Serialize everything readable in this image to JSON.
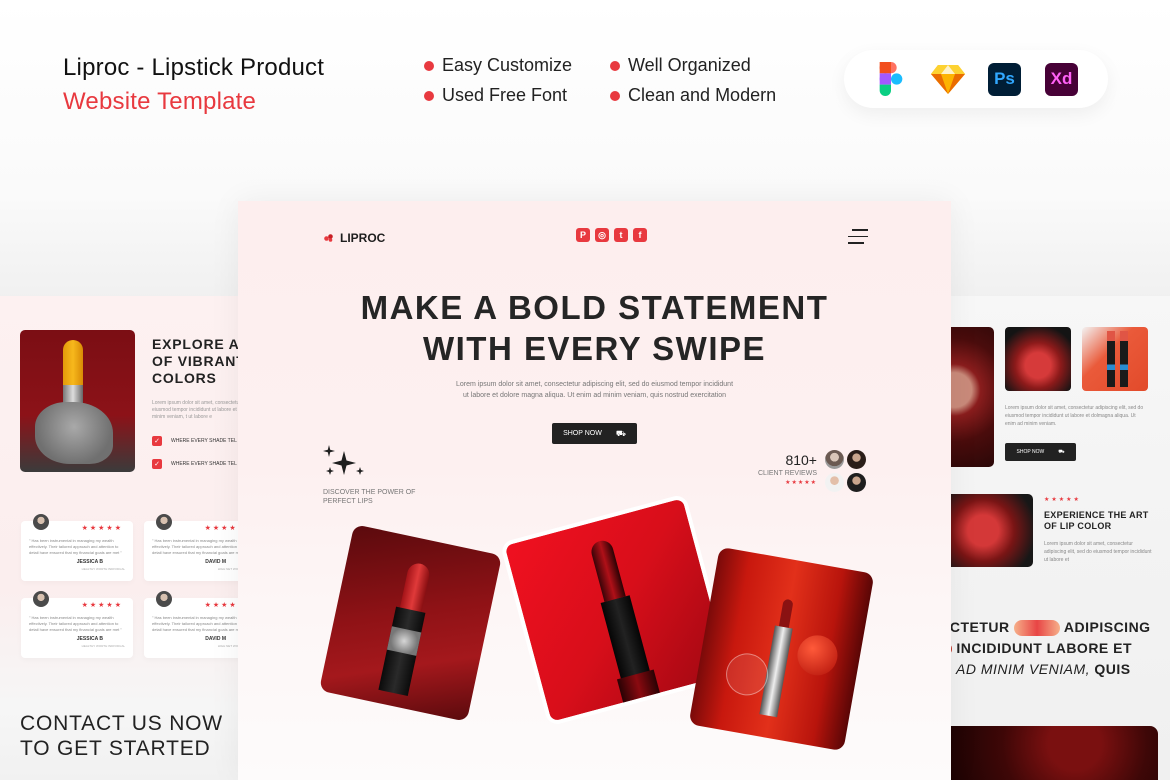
{
  "header": {
    "title_line1": "Liproc - Lipstick Product",
    "title_line2": "Website Template",
    "features": [
      "Easy Customize",
      "Well Organized",
      "Used Free Font",
      "Clean and Modern"
    ],
    "tools": [
      {
        "name": "figma-icon",
        "label": ""
      },
      {
        "name": "sketch-icon",
        "label": ""
      },
      {
        "name": "photoshop-icon",
        "label": "Ps"
      },
      {
        "name": "xd-icon",
        "label": "Xd"
      }
    ]
  },
  "main": {
    "logo": "LIPROC",
    "social": [
      "P",
      "◎",
      "t",
      "f"
    ],
    "hero_line1": "MAKE A BOLD STATEMENT",
    "hero_line2": "WITH EVERY SWIPE",
    "subtext_line1": "Lorem ipsum dolor sit amet, consectetur adipiscing elit, sed do eiusmod tempor incididunt",
    "subtext_line2": "ut labore et dolore magna aliqua. Ut enim ad minim veniam, quis nostrud exercitation",
    "shop_label": "SHOP NOW",
    "cart_icon": "🛒",
    "sparkle": "✦",
    "discover_line1": "DISCOVER THE POWER OF",
    "discover_line2": "PERFECT LIPS",
    "reviews_count": "810+",
    "reviews_label": "CLIENT REVIEWS",
    "reviews_stars": "★★★★★"
  },
  "left": {
    "explore_line1": "EXPLORE A V",
    "explore_line2": "OF VIBRANT",
    "explore_line3": "COLORS",
    "text": "Lorem ipsum dolor sit amet, consectetur adi eiusmod tempor incididunt ut labore et dolm minim veniam, t ut labore e",
    "checks": [
      "WHERE EVERY SHADE TEL",
      "WHERE EVERY SHADE TEL"
    ],
    "testimonials": [
      {
        "quote": "\" Has been instrumental in managing my wealth effectively. Their tailored approach and attention to detail have ensured that my financial goals are met \"",
        "name": "JESSICA B",
        "role": "HEALTHY WORTH INDIVIDUAL",
        "stars": "★★★★★"
      },
      {
        "quote": "\" Has been instrumental in managing my wealth effectively. Their tailored approach and attention to detail have ensured that my financial goals are met \"",
        "name": "DAVID M",
        "role": "HIGH NET WORTH IN",
        "stars": "★★★★★"
      },
      {
        "quote": "\" Has been instrumental in managing my wealth effectively. Their tailored approach and attention to detail have ensured that my financial goals are met \"",
        "name": "JESSICA B",
        "role": "HEALTHY WORTH INDIVIDUAL",
        "stars": "★★★★★"
      },
      {
        "quote": "\" Has been instrumental in managing my wealth effectively. Their tailored approach and attention to detail have ensured that my financial goals are met \"",
        "name": "DAVID M",
        "role": "HIGH NET WORTH IN",
        "stars": "★★★★★"
      }
    ],
    "contact_line1": "CONTACT US NOW",
    "contact_line2": "TO GET STARTED"
  },
  "right": {
    "text": "Lorem ipsum dolor sit amet, consectetur adipiscing elit, sed do eiusmod tempor incididunt ut labore et dolmagna aliqua. Ut enim ad minim veniam.",
    "shop_label": "SHOP NOW",
    "stars": "★★★★★",
    "experience_line1": "EXPERIENCE THE ART",
    "experience_line2": "OF LIP COLOR",
    "text2": "Lorem ipsum dolor sit amet, consectetur adipiscing elit, sed do eiusmod tempor incididunt ut labore et",
    "big_line1a": "ECTETUR",
    "big_line1b": "ADIPISCING",
    "big_line2": "INCIDIDUNT LABORE ET",
    "big_line3a": "AD MINIM VENIAM,",
    "big_line3b": "QUIS"
  },
  "colors": {
    "accent": "#e8393f",
    "dark": "#222222"
  }
}
